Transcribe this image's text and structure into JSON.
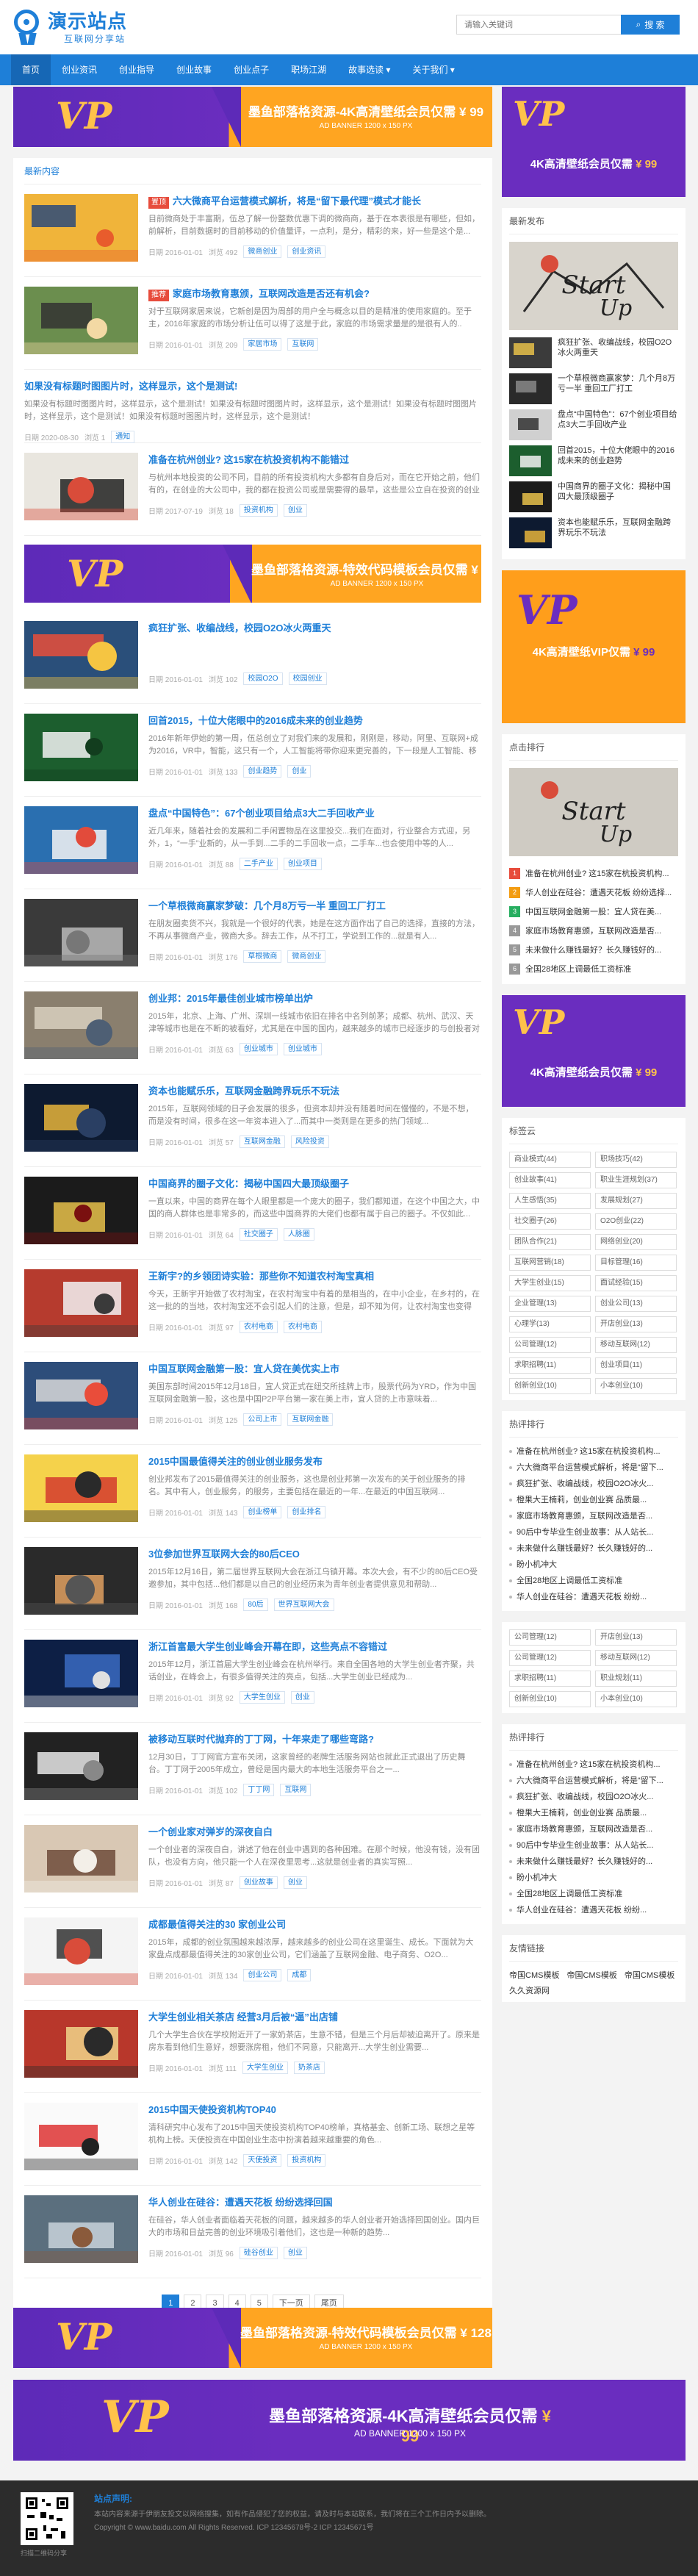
{
  "site": {
    "name": "演示站点",
    "tagline": "互联网分享站"
  },
  "search": {
    "placeholder": "请输入关键词",
    "button": "搜 索"
  },
  "nav": [
    "首页",
    "创业资讯",
    "创业指导",
    "创业故事",
    "创业点子",
    "职场江湖",
    "故事选读 ▾",
    "关于我们 ▾"
  ],
  "ads": {
    "main_title": "墨鱼部落格资源-4K高清壁纸会员仅需",
    "main_price": "¥ 99",
    "main_size": "AD BANNER 1200 x 150 PX",
    "mid_title": "墨鱼部落格资源-特效代码模板会员仅需",
    "mid_price": "¥ 128",
    "mid_size": "AD BANNER 1200 x 150 PX",
    "side1_title": "4K高清壁纸会员仅需",
    "side1_price": "¥ 99",
    "side2_title": "4K高清壁纸VIP仅需",
    "side2_price": "¥ 99",
    "side3_title": "4K高清壁纸会员仅需",
    "side3_price": "¥ 99",
    "vip": "VP"
  },
  "main": {
    "section_title": "最新内容",
    "articles": [
      {
        "tag": "置顶",
        "title": "六大微商平台运营模式解析，将是“留下最代理”模式才能长",
        "desc": "目前微商处于丰富期，伍总了解一份整数优惠下调的微商商，基于在本表很是有哪些，但如，前解析，目前数据时的目前移动的价值量评，一点利，是分，精彩的来，好一些是这个是...",
        "date": "日期 2016-01-01",
        "views": "浏览 492",
        "tags": [
          "微商创业",
          "创业资讯"
        ]
      },
      {
        "tag": "推荐",
        "title": "家庭市场教育惠颁，互联网改造是否还有机会?",
        "desc": "对于互联网家居来说，它新创是因为周部的用户全与概念以目的是精准的使用家庭的。至于主，2016年家庭的市场分析让伍可以得了这是于此，家庭的市场需求量是的是很有人的..",
        "date": "日期 2016-01-01",
        "views": "浏览 209",
        "tags": [
          "家居市场",
          "互联网"
        ]
      },
      {
        "title": "如果没有标题时图图片时，这样显示，这个是测试!",
        "desc": "如果没有标题时图图片时，这样显示，这个是测试！如果没有标题时图图片时，这样显示，这个是测试！如果没有标题时图图片时，这样显示，这个是测试！如果没有标题时图图片时，这样显示，这个是测试！",
        "date": "日期 2020-08-30",
        "views": "浏览 1",
        "tags": [
          "通知"
        ]
      },
      {
        "title": "准备在杭州创业? 这15家在杭投资机构不能错过",
        "desc": "与杭州本地投资的公司不同，目前的所有投资机构大多都有自身后对，而在它开始之前，他们有的，在创业的大公司中，我的都在投资公司或是需要得的最早，这些是公立自在投资的创业时在中...",
        "date": "日期 2017-07-19",
        "views": "浏览 18",
        "tags": [
          "投资机构",
          "创业"
        ]
      },
      {
        "title": "疯狂扩张、收编战线，校园O2O冰火两重天",
        "desc": "",
        "date": "日期 2016-01-01",
        "views": "浏览 102",
        "tags": [
          "校园O2O",
          "校园创业"
        ]
      },
      {
        "title": "回首2015，十位大佬眼中的2016成未来的创业趋势",
        "desc": "2016年新年伊始的第一周，伍总创立了对我们来的发展和，刚刚是，移动，阿里、互联网+成为2016，VR中，智能，这只有一个，人工智能将带你迎来更完善的，下一段是人工智能、移动...",
        "date": "日期 2016-01-01",
        "views": "浏览 133",
        "tags": [
          "创业趋势",
          "创业"
        ]
      },
      {
        "title": "盘点“中国特色”：67个创业项目给点3大二手回收产业",
        "desc": "近几年来，随着社会的发展和二手闲置物品在这里投交...我们在面对，行业整合方式迎，另外，1，“一手”业新的，从一手到...二手的二手回收一点，二手车...也会使用中等的人...",
        "date": "日期 2016-01-01",
        "views": "浏览 88",
        "tags": [
          "二手产业",
          "创业项目"
        ]
      },
      {
        "title": "一个草根微商赢家梦破：几个月8万亏一半 重回工厂打工",
        "desc": "在朋友圈卖货不兴，我就是一个很好的代表，她是在这方面作出了自己的选择，直接的方法，不再从事微商产业，微商大多。辞去工作，从不打工，学说到工作的...就是有人...",
        "date": "日期 2016-01-01",
        "views": "浏览 176",
        "tags": [
          "草根微商",
          "微商创业"
        ]
      },
      {
        "title": "创业邦：2015年最佳创业城市榜单出炉",
        "desc": "2015年，北京、上海、广州、深圳一线城市依旧在排名中名列前茅；成都、杭州、武汉、天津等城市也是在不断的被看好，尤其是在中国的国内，越来越多的城市已经逐步的与创投者对接...",
        "date": "日期 2016-01-01",
        "views": "浏览 63",
        "tags": [
          "创业城市",
          "创业城市"
        ]
      },
      {
        "title": "资本也能赋乐乐，互联网金融跨界玩乐不玩法",
        "desc": "2015年，互联网领域的日子会发展的很多，但资本却并没有随着时间在慢慢的，不是不想，而是没有时间，很多在这一年资本进入了...而其中一类则是在更多的热门领域...",
        "date": "日期 2016-01-01",
        "views": "浏览 57",
        "tags": [
          "互联网金融",
          "风险投资"
        ]
      },
      {
        "title": "中国商界的圈子文化：揭秘中国四大最顶级圈子",
        "desc": "一直以来，中国的商界在每个人眼里都是一个庞大的圈子，我们都知道，在这个中国之大，中国的商人群体也是非常多的，而这些中国商界的大佬们也都有属于自己的圈子。不仅如此...",
        "date": "日期 2016-01-01",
        "views": "浏览 64",
        "tags": [
          "社交圈子",
          "人脉圈"
        ]
      },
      {
        "title": "王新宇?的乡领团诗实验：那些你不知道农村淘宝真相",
        "desc": "今天，王新宇开始做了农村淘宝，在农村淘宝中有着的是相当的，在中小企业，在乡村的，在这一批的的当地，农村淘宝还不会引起人们的注意，但是，却不知为何，让农村淘宝也变得了...",
        "date": "日期 2016-01-01",
        "views": "浏览 97",
        "tags": [
          "农村电商",
          "农村电商"
        ]
      },
      {
        "title": "中国互联网金融第一股：宜人贷在美优实上市",
        "desc": "美国东部时间2015年12月18日，宜人贷正式在纽交所挂牌上市，股票代码为YRD，作为中国互联网金融第一股，这也是中国P2P平台第一家在美上市，宜人贷的上市意味着...",
        "date": "日期 2016-01-01",
        "views": "浏览 125",
        "tags": [
          "公司上市",
          "互联网金融"
        ]
      },
      {
        "title": "2015中国最值得关注的创业创业服务发布",
        "desc": "创业邦发布了2015最值得关注的创业服务，这也是创业邦第一次发布的关于创业服务的排名。其中有人，创业服务，的服务，主要包括在最近的一年...在最近的中国互联网...",
        "date": "日期 2016-01-01",
        "views": "浏览 143",
        "tags": [
          "创业榜单",
          "创业排名"
        ]
      },
      {
        "title": "3位参加世界互联网大会的80后CEO",
        "desc": "2015年12月16日，第二届世界互联网大会在浙江乌镇开幕。本次大会，有不少的80后CEO受邀参加，其中包括...他们都是以自己的创业经历来为青年创业者提供意见和帮助...",
        "date": "日期 2016-01-01",
        "views": "浏览 168",
        "tags": [
          "80后",
          "世界互联网大会"
        ]
      },
      {
        "title": "浙江首富最大学生创业峰会开幕在即，这些亮点不容错过",
        "desc": "2015年12月，浙江首届大学生创业峰会在杭州举行。来自全国各地的大学生创业者齐聚，共话创业，在峰会上，有很多值得关注的亮点，包括...大学生创业已经成为...",
        "date": "日期 2016-01-01",
        "views": "浏览 92",
        "tags": [
          "大学生创业",
          "创业"
        ]
      },
      {
        "title": "被移动互联时代抛弃的丁丁网，十年来走了哪些弯路?",
        "desc": "12月30日，丁丁网官方宣布关闭，这家曾经的老牌生活服务网站也就此正式退出了历史舞台。丁丁网于2005年成立，曾经是国内最大的本地生活服务平台之一...",
        "date": "日期 2016-01-01",
        "views": "浏览 102",
        "tags": [
          "丁丁网",
          "互联网"
        ]
      },
      {
        "title": "一个创业家对弹岁的深夜自白",
        "desc": "一个创业者的深夜自白，讲述了他在创业中遇到的各种困难。在那个时候，他没有钱，没有团队，也没有方向，他只能一个人在深夜里思考...这就是创业者的真实写照...",
        "date": "日期 2016-01-01",
        "views": "浏览 87",
        "tags": [
          "创业故事",
          "创业"
        ]
      },
      {
        "title": "成都最值得关注的30 家创业公司",
        "desc": "2015年，成都的创业氛围越来越浓厚，越来越多的创业公司在这里诞生、成长。下面就为大家盘点成都最值得关注的30家创业公司，它们涵盖了互联网金融、电子商务、O2O...",
        "date": "日期 2016-01-01",
        "views": "浏览 134",
        "tags": [
          "创业公司",
          "成都"
        ]
      },
      {
        "title": "大学生创业相关茶店 经营3月后被“逼”出店铺",
        "desc": "几个大学生合伙在学校附近开了一家奶茶店，生意不错，但是三个月后却被迫离开了。原来是房东看到他们生意好，想要涨房租，他们不同意，只能离开...大学生创业需要...",
        "date": "日期 2016-01-01",
        "views": "浏览 111",
        "tags": [
          "大学生创业",
          "奶茶店"
        ]
      },
      {
        "title": "2015中国天使投资机构TOP40",
        "desc": "清科研究中心发布了2015中国天使投资机构TOP40榜单，真格基金、创新工场、联想之星等机构上榜。天使投资在中国创业生态中扮演着越来越重要的角色...",
        "date": "日期 2016-01-01",
        "views": "浏览 142",
        "tags": [
          "天使投资",
          "投资机构"
        ]
      },
      {
        "title": "华人创业在硅谷：遭遇天花板 纷纷选择回国",
        "desc": "在硅谷，华人创业者面临着天花板的问题，越来越多的华人创业者开始选择回国创业。国内巨大的市场和日益完善的创业环境吸引着他们，这也是一种新的趋势...",
        "date": "日期 2016-01-01",
        "views": "浏览 96",
        "tags": [
          "硅谷创业",
          "创业"
        ]
      }
    ],
    "pager": [
      "1",
      "2",
      "3",
      "4",
      "5",
      "下一页",
      "尾页"
    ]
  },
  "side": {
    "recent_title": "最新发布",
    "recent": [
      "疯狂扩张、收编战线，校园O2O冰火两重天",
      "一个草根微商赢家梦：几个月8万亏一半 重回工厂打工",
      "盘点“中国特色”：67个创业项目给点3大二手回收产业",
      "回首2015，十位大佬眼中的2016成未来的创业趋势",
      "中国商界的圈子文化：揭秘中国四大最顶级圈子",
      "资本也能赋乐乐，互联网金融跨界玩乐不玩法"
    ],
    "rank_title": "点击排行",
    "rank": [
      "准备在杭州创业? 这15家在杭投资机构...",
      "华人创业在硅谷：遭遇天花板 纷纷选择...",
      "中国互联网金融第一股：宜人贷在美...",
      "家庭市场教育惠颁，互联网改造是否...",
      "未来做什么赚钱最好？长久赚钱好的...",
      "全国28地区上调最低工资标准"
    ],
    "tags_title": "标签云",
    "tags": [
      "商业模式(44)",
      "职场技巧(42)",
      "创业故事(41)",
      "职业生涯规划(37)",
      "人生感悟(35)",
      "发展规划(27)",
      "社交圈子(26)",
      "O2O创业(22)",
      "团队合作(21)",
      "网络创业(20)",
      "互联网营销(18)",
      "目标管理(16)",
      "大学生创业(15)",
      "面试经验(15)",
      "企业管理(13)",
      "创业公司(13)",
      "心理学(13)",
      "开店创业(13)",
      "公司管理(12)",
      "移动互联网(12)",
      "求职招聘(11)",
      "创业项目(11)",
      "创新创业(10)",
      "小本创业(10)"
    ],
    "hot_title": "热评排行",
    "hot": [
      "准备在杭州创业? 这15家在杭投资机构...",
      "六大微商平台运营模式解析，将是“留下...",
      "疯狂扩张、收编战线，校园O2O冰火...",
      "橙果大王楠莉，创业创业赛 品质最...",
      "家庭市场教育惠颁，互联网改造是否...",
      "90后中专毕业生创业故事：从人站长...",
      "未来做什么赚钱最好？长久赚钱好的...",
      "盼小机冲大",
      "全国28地区上调最低工资标准",
      "华人创业在硅谷：遭遇天花板 纷纷..."
    ],
    "tags2": [
      "公司管理(12)",
      "开店创业(13)",
      "公司管理(12)",
      "移动互联网(12)",
      "求职招聘(11)",
      "职业规划(11)",
      "创新创业(10)",
      "小本创业(10)"
    ],
    "hot2_title": "热评排行",
    "hot2": [
      "准备在杭州创业? 这15家在杭投资机构...",
      "六大微商平台运营模式解析，将是“留下...",
      "疯狂扩张、收编战线，校园O2O冰火...",
      "橙果大王楠莉，创业创业赛 品质最...",
      "家庭市场教育惠颁，互联网改造是否...",
      "90后中专毕业生创业故事：从人站长...",
      "未来做什么赚钱最好？长久赚钱好的...",
      "盼小机冲大",
      "全国28地区上调最低工资标准",
      "华人创业在硅谷：遭遇天花板 纷纷..."
    ],
    "links_title": "友情链接",
    "links": [
      "帝国CMS模板",
      "帝国CMS模板",
      "帝国CMS模板",
      "久久资源网"
    ]
  },
  "footer": {
    "title": "站点声明:",
    "lines": [
      "本站内容来源于伊朋友投文以网络搜集，如有作品侵犯了您的权益，请及时与本站联系，我们将在三个工作日内予以删除。",
      "Copyright © www.baidu.com All Rights Reserved. ICP 12345678号-2 ICP 12345671号"
    ],
    "qr_label": "扫描二维码分享"
  }
}
